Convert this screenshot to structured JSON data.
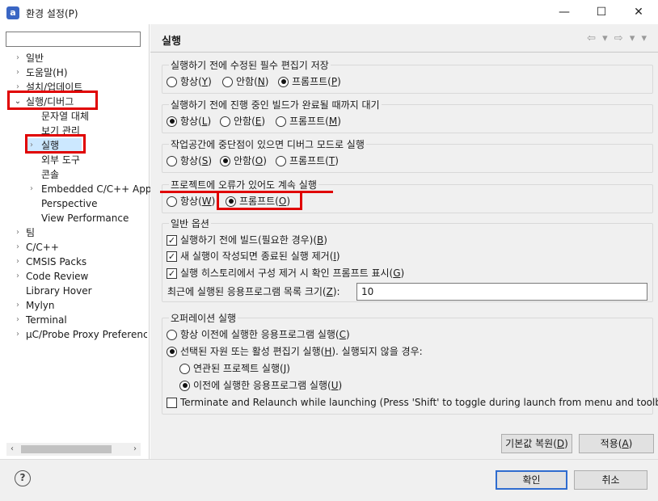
{
  "window": {
    "title": "환경 설정(P)",
    "icon": "a",
    "minimize": "—",
    "maximize": "☐",
    "close": "✕"
  },
  "tree": {
    "filter_value": "",
    "items": [
      {
        "label": "일반",
        "twisty": "›"
      },
      {
        "label": "도움말(H)",
        "twisty": "›"
      },
      {
        "label": "설치/업데이트",
        "twisty": "›"
      },
      {
        "label": "실행/디버그",
        "twisty": "⌄"
      },
      {
        "label": "문자열 대체",
        "twisty": ""
      },
      {
        "label": "보기 관리",
        "twisty": ""
      },
      {
        "label": "실행",
        "twisty": "›"
      },
      {
        "label": "외부 도구",
        "twisty": ""
      },
      {
        "label": "콘솔",
        "twisty": ""
      },
      {
        "label": "Embedded C/C++ App",
        "twisty": "›"
      },
      {
        "label": "Perspective",
        "twisty": ""
      },
      {
        "label": "View Performance",
        "twisty": ""
      },
      {
        "label": "팀",
        "twisty": "›"
      },
      {
        "label": "C/C++",
        "twisty": "›"
      },
      {
        "label": "CMSIS Packs",
        "twisty": "›"
      },
      {
        "label": "Code Review",
        "twisty": "›"
      },
      {
        "label": "Library Hover",
        "twisty": ""
      },
      {
        "label": "Mylyn",
        "twisty": "›"
      },
      {
        "label": "Terminal",
        "twisty": "›"
      },
      {
        "label": "µC/Probe Proxy Preference",
        "twisty": "›"
      }
    ],
    "scroll_left": "‹",
    "scroll_right": "›"
  },
  "page": {
    "title": "실행",
    "nav": "⇦ ▾ ⇨ ▾ ▾"
  },
  "groups": {
    "g1": {
      "legend": "실행하기 전에 수정된 필수 편집기 저장",
      "options": [
        {
          "label": "항상",
          "mn": "Y"
        },
        {
          "label": "안함",
          "mn": "N"
        },
        {
          "label": "프롬프트",
          "mn": "P"
        }
      ]
    },
    "g2": {
      "legend": "실행하기 전에 진행 중인 빌드가 완료될 때까지 대기",
      "options": [
        {
          "label": "항상",
          "mn": "L"
        },
        {
          "label": "안함",
          "mn": "E"
        },
        {
          "label": "프롬프트",
          "mn": "M"
        }
      ]
    },
    "g3": {
      "legend": "작업공간에 중단점이 있으면 디버그 모드로 실행",
      "options": [
        {
          "label": "항상",
          "mn": "S"
        },
        {
          "label": "안함",
          "mn": "O"
        },
        {
          "label": "프롬프트",
          "mn": "T"
        }
      ]
    },
    "g4": {
      "legend": "프로젝트에 오류가 있어도 계속 실행",
      "options": [
        {
          "label": "항상",
          "mn": "W"
        },
        {
          "label": "프롬프트",
          "mn": "O"
        }
      ]
    },
    "g5": {
      "legend": "일반 옵션",
      "checks": [
        {
          "label": "실행하기 전에 빌드(필요한 경우)",
          "mn": "B"
        },
        {
          "label": "새 실행이 작성되면 종료된 실행 제거",
          "mn": "I"
        },
        {
          "label": "실행 히스토리에서 구성 제거 시 확인 프롬프트 표시",
          "mn": "G"
        }
      ],
      "history_label": "최근에 실행된 응용프로그램 목록 크기",
      "history_mn": "Z",
      "history_value": "10"
    },
    "g6": {
      "legend": "오퍼레이션 실행",
      "opt1": {
        "label": "항상 이전에 실행한 응용프로그램 실행",
        "mn": "C"
      },
      "opt2": {
        "label": "선택된 자원 또는 활성 편집기 실행",
        "mn": "H",
        "suffix": ". 실행되지 않을 경우:"
      },
      "sub1": {
        "label": "연관된 프로젝트 실행",
        "mn": "J"
      },
      "sub2": {
        "label": "이전에 실행한 응용프로그램 실행",
        "mn": "U"
      },
      "terminate": "Terminate and Relaunch while launching (Press 'Shift' to toggle during launch from menu and toolbar)"
    }
  },
  "buttons": {
    "restore_defaults": {
      "label": "기본값 복원",
      "mn": "D"
    },
    "apply": {
      "label": "적용",
      "mn": "A"
    },
    "ok": "확인",
    "cancel": "취소",
    "help": "?"
  },
  "colors": {
    "highlight": "#e00000",
    "default_button_border": "#2f6ccf"
  }
}
